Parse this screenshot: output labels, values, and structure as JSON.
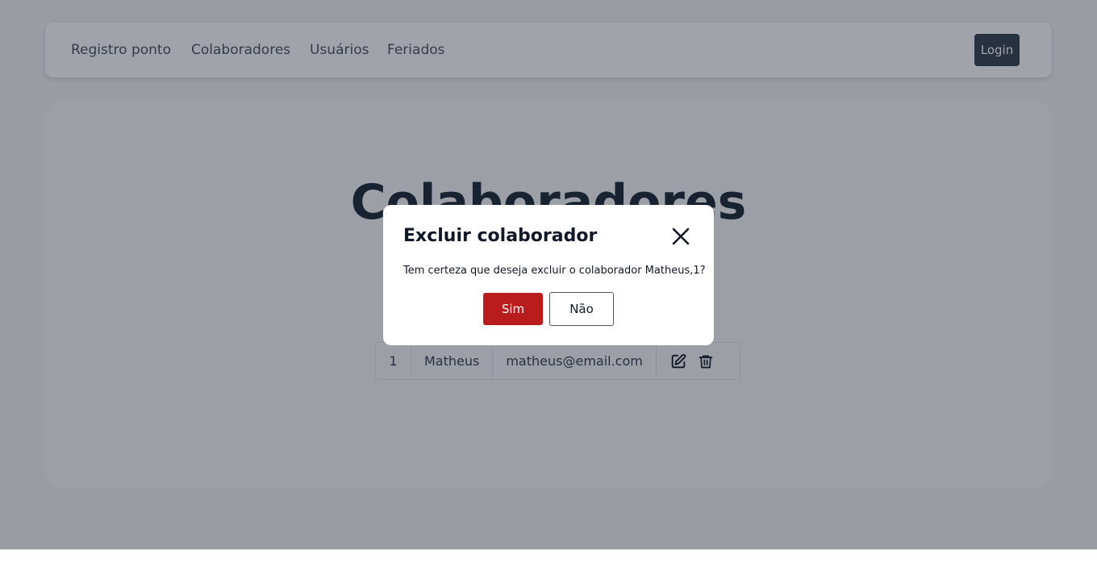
{
  "nav": {
    "links": [
      "Registro ponto",
      "Colaboradores",
      "Usuários",
      "Feriados"
    ],
    "login_label": "Login"
  },
  "page": {
    "title": "Colaboradores"
  },
  "table": {
    "rows": [
      {
        "id": "1",
        "name": "Matheus",
        "email": "matheus@email.com"
      }
    ]
  },
  "icons": {
    "edit": "edit-icon",
    "delete": "trash-icon",
    "close": "close-icon"
  },
  "modal": {
    "title": "Excluir colaborador",
    "message": "Tem certeza que deseja excluir o colaborador Matheus,1?",
    "confirm_label": "Sim",
    "cancel_label": "Não"
  },
  "colors": {
    "confirm": "#b91c1c",
    "login_button": "#374151",
    "overlay": "rgba(17,24,39,0.40)"
  }
}
